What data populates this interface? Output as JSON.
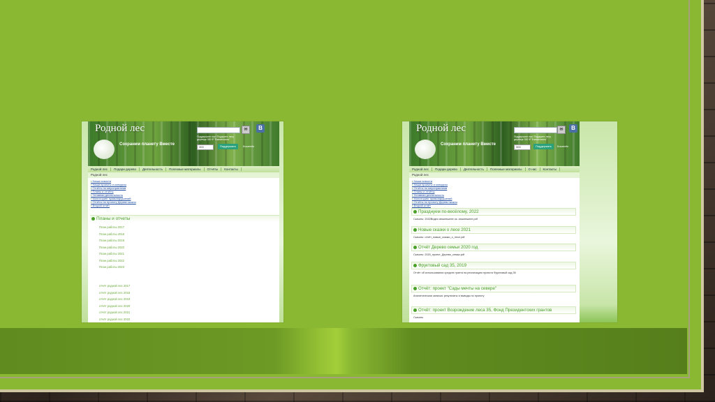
{
  "screens": [
    {
      "logo": "Родной лес",
      "slogan": "Сохраним планету Вместе",
      "subscribe_text": "Поддержите нас! Подарите лесу деревце 300 ₽ \"Ежемесячно\"",
      "qty": "300",
      "subscribe_button": "Поддержать",
      "wallet": "Кошелёк",
      "vk": "В",
      "nav": [
        "Родной лес",
        "Подари дерево",
        "Деятельность",
        "Полезные материалы",
        "Отчёты",
        "Контакты"
      ],
      "crumb": "Родной лес",
      "links": [
        "Наши новости",
        "Наши проекты и конкурсы",
        "Отчёты по мероприятиям",
        "Планы и отчёты",
        "Уставная деятельность",
        "Мониторинг правонарушений",
        "Отчёты по проекту Дерево жизни",
        "Второй отчёт"
      ],
      "plans_title": "Планы и отчеты",
      "plans": [
        "План работы 2017",
        "План работы 2018",
        "План работы 2019",
        "План работы 2020",
        "План работы 2021",
        "План работы 2022",
        "План работы 2023"
      ],
      "reports": [
        "отчёт родной лес 2017",
        "отчёт родной лес 2018",
        "отчёт родной лес 2019",
        "отчёт родной лес 2020",
        "отчёт родной лес 2021",
        "отчёт родной лес 2022"
      ]
    },
    {
      "logo": "Родной лес",
      "slogan": "Сохраним планету Вместе",
      "subscribe_text": "Поддержите нас! Подарите лесу деревце 300 ₽ \"Ежемесячно\"",
      "qty": "300",
      "subscribe_button": "Поддержать",
      "wallet": "Кошелёк",
      "vk": "В",
      "nav": [
        "Родной лес",
        "Подари дерево",
        "Деятельность",
        "Полезные материалы",
        "О нас",
        "Контакты"
      ],
      "crumb": "Родной лес",
      "links": [
        "Наши новости",
        "Наши проекты и конкурсы",
        "Отчёты по мероприятиям",
        "Планы и отчёты",
        "Уставная деятельность",
        "Мониторинг правонарушений",
        "Отчёты по проекту Дерево жизни",
        "Второй отчёт"
      ],
      "sections": [
        {
          "title": "Празднуем по-весёлому, 2022",
          "body": "Скачать: 2022Видео апшнешнее ок. апшнешнее.pdf"
        },
        {
          "title": "Новые сказки о лесе 2021",
          "body": "Скачать: отчёт_новые_сказки_о_лесе.pdf"
        },
        {
          "title": "Отчёт Дерево семьи 2020 год",
          "body": "Скачать: 2020_проект_Дерево_семьи.pdf"
        },
        {
          "title": "Фруктовый сад 35, 2019",
          "body": "Отчёт об использовании средств гранта на реализацию проекта Фруктовый сад 35"
        },
        {
          "title": "Отчёт: проект \"Сады мечты на севере\"",
          "body": "Аналитическая записка: результаты и выводы по проекту"
        },
        {
          "title": "Отчёт: проект Возрождение леса 35, Фонд Президентских грантов",
          "body": "Скачать"
        }
      ]
    }
  ]
}
